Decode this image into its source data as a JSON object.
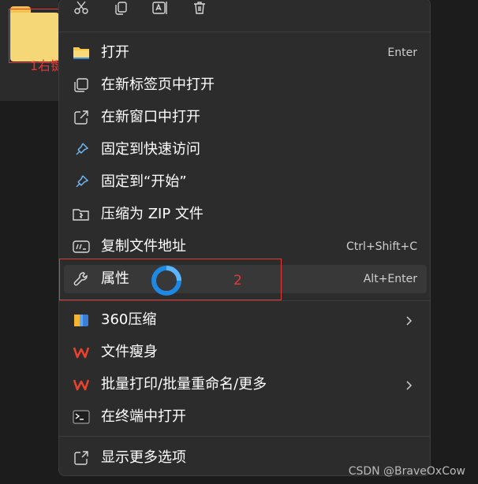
{
  "desktop": {
    "annotation_label": "1右键"
  },
  "toolbar": {
    "icons": [
      "cut-icon",
      "copy-icon",
      "rename-icon",
      "delete-icon"
    ]
  },
  "menu": {
    "items": [
      {
        "label": "打开",
        "shortcut": "Enter",
        "icon": "folder-icon"
      },
      {
        "label": "在新标签页中打开",
        "shortcut": "",
        "icon": "new-tab-icon"
      },
      {
        "label": "在新窗口中打开",
        "shortcut": "",
        "icon": "new-window-icon"
      },
      {
        "label": "固定到快速访问",
        "shortcut": "",
        "icon": "pin-icon"
      },
      {
        "label": "固定到“开始”",
        "shortcut": "",
        "icon": "pin-icon"
      },
      {
        "label": "压缩为 ZIP 文件",
        "shortcut": "",
        "icon": "zip-icon"
      },
      {
        "label": "复制文件地址",
        "shortcut": "Ctrl+Shift+C",
        "icon": "copy-path-icon"
      },
      {
        "label": "属性",
        "shortcut": "Alt+Enter",
        "icon": "wrench-icon"
      },
      {
        "label": "360压缩",
        "shortcut": "",
        "icon": "archive-360-icon",
        "submenu": true
      },
      {
        "label": "文件瘦身",
        "shortcut": "",
        "icon": "wps-icon"
      },
      {
        "label": "批量打印/批量重命名/更多",
        "shortcut": "",
        "icon": "wps-icon",
        "submenu": true
      },
      {
        "label": "在终端中打开",
        "shortcut": "",
        "icon": "terminal-icon"
      },
      {
        "label": "显示更多选项",
        "shortcut": "",
        "icon": "more-options-icon"
      }
    ]
  },
  "annotations": {
    "step2_label": "2",
    "color": "#e53935"
  },
  "watermark": "CSDN @BraveOxCow",
  "colors": {
    "menu_bg": "#2c2c2c",
    "hover_bg": "#383838",
    "accent": "#2196f3",
    "wps_red": "#e8412c"
  }
}
